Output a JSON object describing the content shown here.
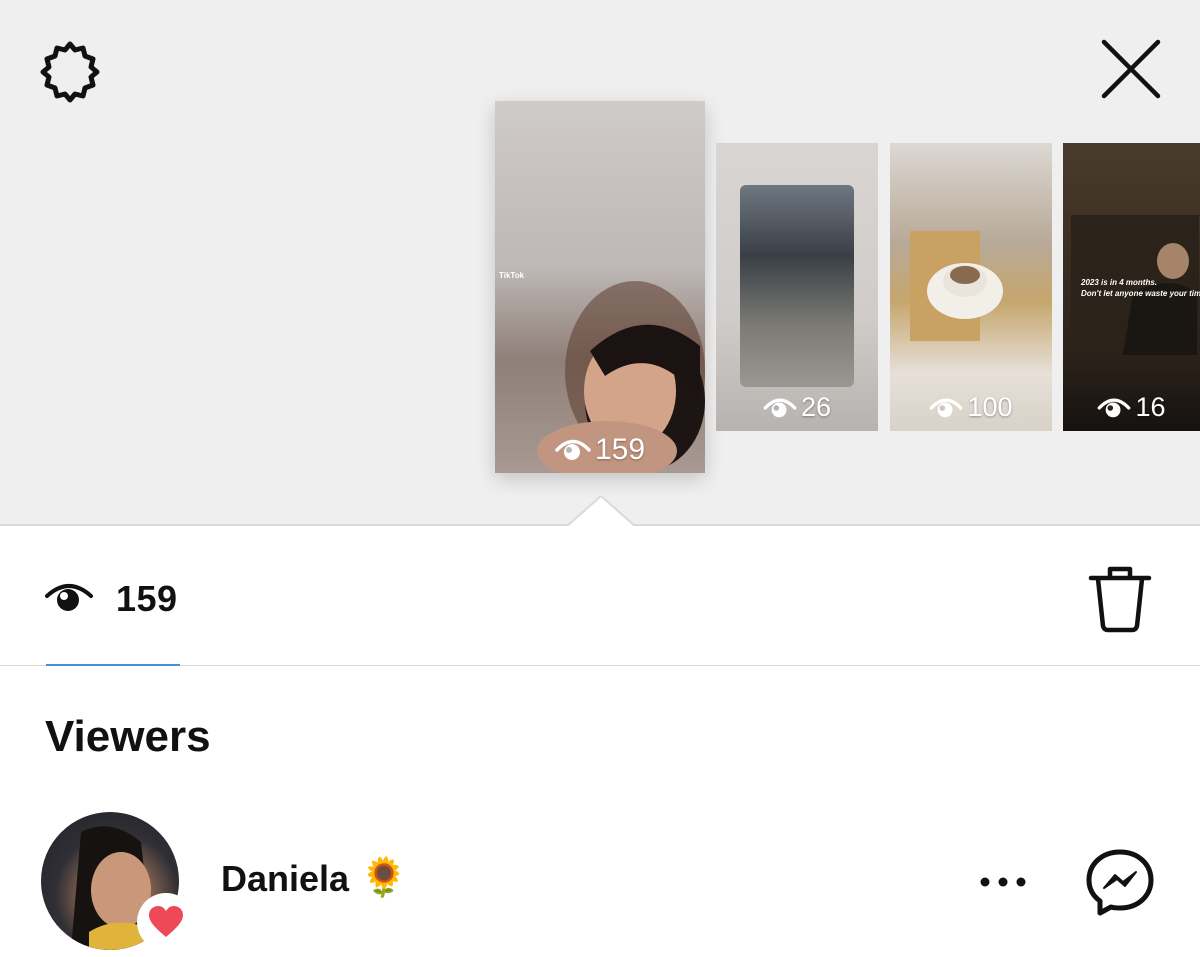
{
  "stories": [
    {
      "views": "159"
    },
    {
      "views": "26"
    },
    {
      "views": "100"
    },
    {
      "views": "16"
    }
  ],
  "story_text": {
    "tiktok_label": "TikTok",
    "quote_line1": "2023 is in 4 months.",
    "quote_line2": "Don't let anyone waste your time"
  },
  "stats": {
    "view_count": "159"
  },
  "viewers": {
    "section_title": "Viewers",
    "list": [
      {
        "name": "Daniela",
        "emoji": "🌻",
        "reaction": "heart"
      }
    ]
  },
  "icons": {
    "settings": "gear-icon",
    "close": "close-icon",
    "eye": "eye-icon",
    "delete": "trash-icon",
    "more": "more-icon",
    "message": "messenger-icon",
    "reaction": "heart-icon"
  },
  "colors": {
    "tray_bg": "#efefef",
    "accent_underline": "#4a8fd6",
    "heart": "#ed4956"
  }
}
